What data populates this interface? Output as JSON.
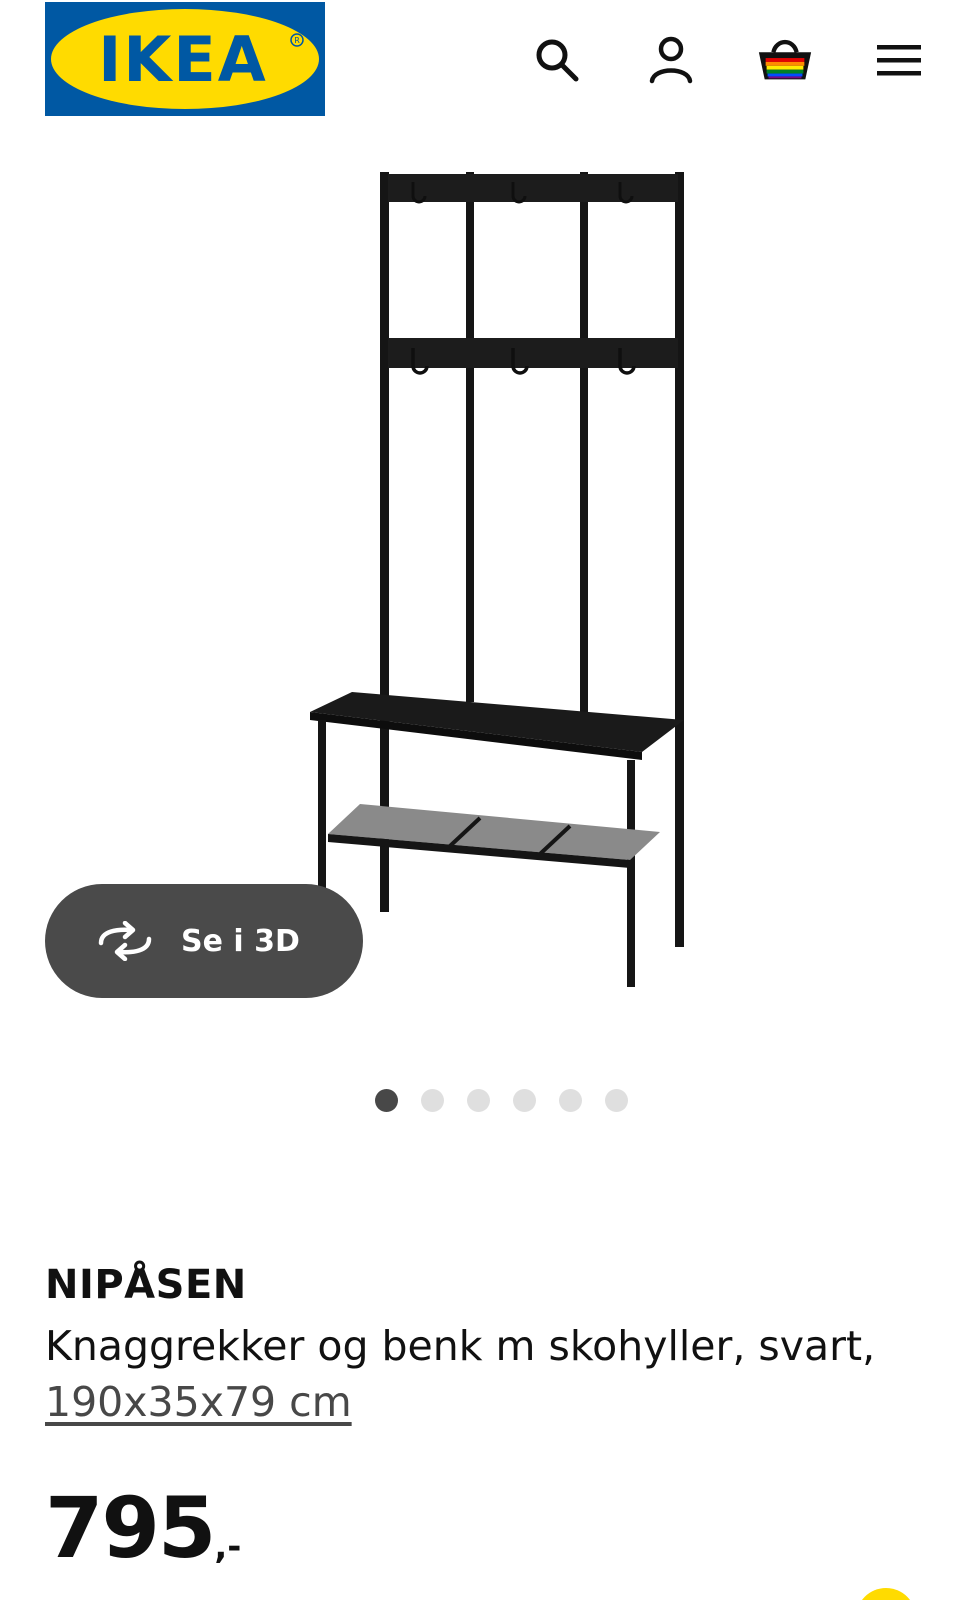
{
  "header": {
    "logo_text": "IKEA",
    "logo_colors": {
      "background": "#0058a3",
      "ellipse": "#ffdb00",
      "text": "#0058a3"
    },
    "icons": [
      "search-icon",
      "user-icon",
      "basket-icon",
      "menu-icon"
    ]
  },
  "gallery": {
    "view_3d_label": "Se i 3D",
    "view_3d_icon": "rotate-3d-icon",
    "slide_count": 6,
    "active_slide": 1
  },
  "product": {
    "name": "NIPÅSEN",
    "description": "Knaggrekker og benk m skohyller, svart,",
    "size": "190x35x79 cm",
    "price_amount": "795",
    "price_suffix": ",-"
  },
  "colors": {
    "text": "#111111",
    "muted": "#484848",
    "button_bg": "#4a4a4a",
    "dot_active": "#484848",
    "dot_inactive": "#dfdfdf"
  }
}
